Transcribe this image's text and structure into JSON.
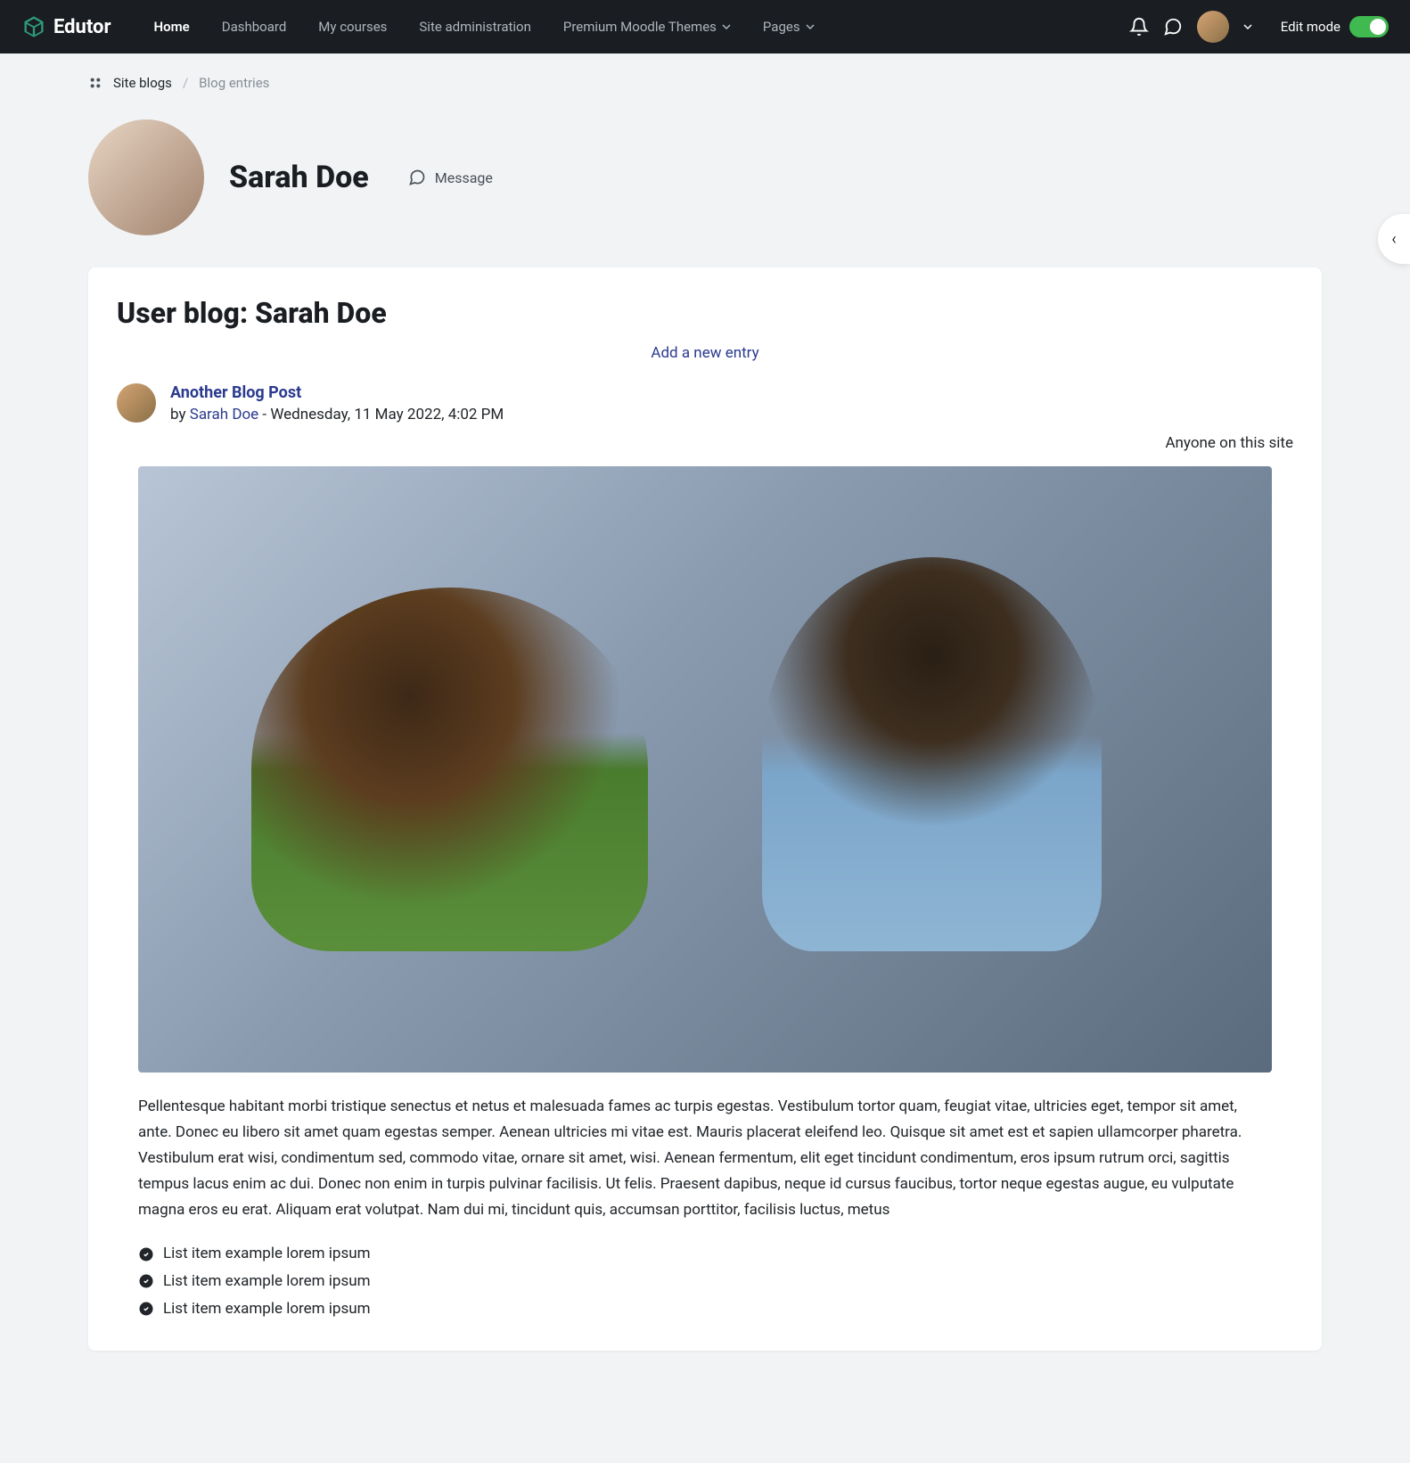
{
  "brand": {
    "name": "Edutor"
  },
  "nav": {
    "home": "Home",
    "dashboard": "Dashboard",
    "mycourses": "My courses",
    "siteadmin": "Site administration",
    "themes": "Premium Moodle Themes",
    "pages": "Pages"
  },
  "edit_mode_label": "Edit mode",
  "breadcrumb": {
    "site_blogs": "Site blogs",
    "current": "Blog entries"
  },
  "profile": {
    "name": "Sarah Doe",
    "message": "Message"
  },
  "blog": {
    "title": "User blog: Sarah Doe",
    "add_entry": "Add a new entry",
    "post": {
      "title": "Another Blog Post",
      "by_label": "by",
      "author": "Sarah Doe",
      "date": "Wednesday, 11 May 2022, 4:02 PM",
      "visibility": "Anyone on this site",
      "body": "Pellentesque habitant morbi tristique senectus et netus et malesuada fames ac turpis egestas. Vestibulum tortor quam, feugiat vitae, ultricies eget, tempor sit amet, ante. Donec eu libero sit amet quam egestas semper. Aenean ultricies mi vitae est. Mauris placerat eleifend leo. Quisque sit amet est et sapien ullamcorper pharetra. Vestibulum erat wisi, condimentum sed, commodo vitae, ornare sit amet, wisi. Aenean fermentum, elit eget tincidunt condimentum, eros ipsum rutrum orci, sagittis tempus lacus enim ac dui. Donec non enim in turpis pulvinar facilisis. Ut felis. Praesent dapibus, neque id cursus faucibus, tortor neque egestas augue, eu vulputate magna eros eu erat. Aliquam erat volutpat. Nam dui mi, tincidunt quis, accumsan porttitor, facilisis luctus, metus",
      "list": [
        "List item example lorem ipsum",
        "List item example lorem ipsum",
        "List item example lorem ipsum"
      ]
    }
  }
}
